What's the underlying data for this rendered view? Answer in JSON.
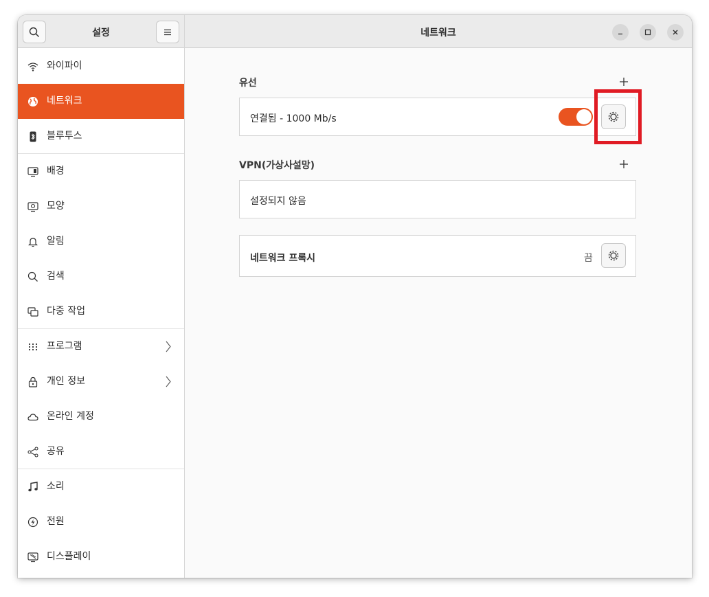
{
  "sidebar": {
    "title": "설정",
    "items": [
      {
        "label": "와이파이",
        "icon": "wifi-icon"
      },
      {
        "label": "네트워크",
        "icon": "globe-icon"
      },
      {
        "label": "블루투스",
        "icon": "bluetooth-icon"
      },
      {
        "label": "배경",
        "icon": "background-icon"
      },
      {
        "label": "모양",
        "icon": "appearance-icon"
      },
      {
        "label": "알림",
        "icon": "bell-icon"
      },
      {
        "label": "검색",
        "icon": "search-icon"
      },
      {
        "label": "다중 작업",
        "icon": "multitasking-icon"
      },
      {
        "label": "프로그램",
        "icon": "apps-grid-icon"
      },
      {
        "label": "개인 정보",
        "icon": "lock-icon"
      },
      {
        "label": "온라인 계정",
        "icon": "cloud-icon"
      },
      {
        "label": "공유",
        "icon": "share-icon"
      },
      {
        "label": "소리",
        "icon": "music-note-icon"
      },
      {
        "label": "전원",
        "icon": "power-icon"
      },
      {
        "label": "디스플레이",
        "icon": "display-icon"
      }
    ]
  },
  "header": {
    "title": "네트워크"
  },
  "wired": {
    "title": "유선",
    "status": "연결됨 - 1000 Mb/s",
    "enabled": true
  },
  "vpn": {
    "title": "VPN(가상사설망)",
    "status": "설정되지 않음"
  },
  "proxy": {
    "label": "네트워크 프록시",
    "status": "끔"
  },
  "colors": {
    "accent": "#e95420",
    "highlight": "#e01b24"
  }
}
